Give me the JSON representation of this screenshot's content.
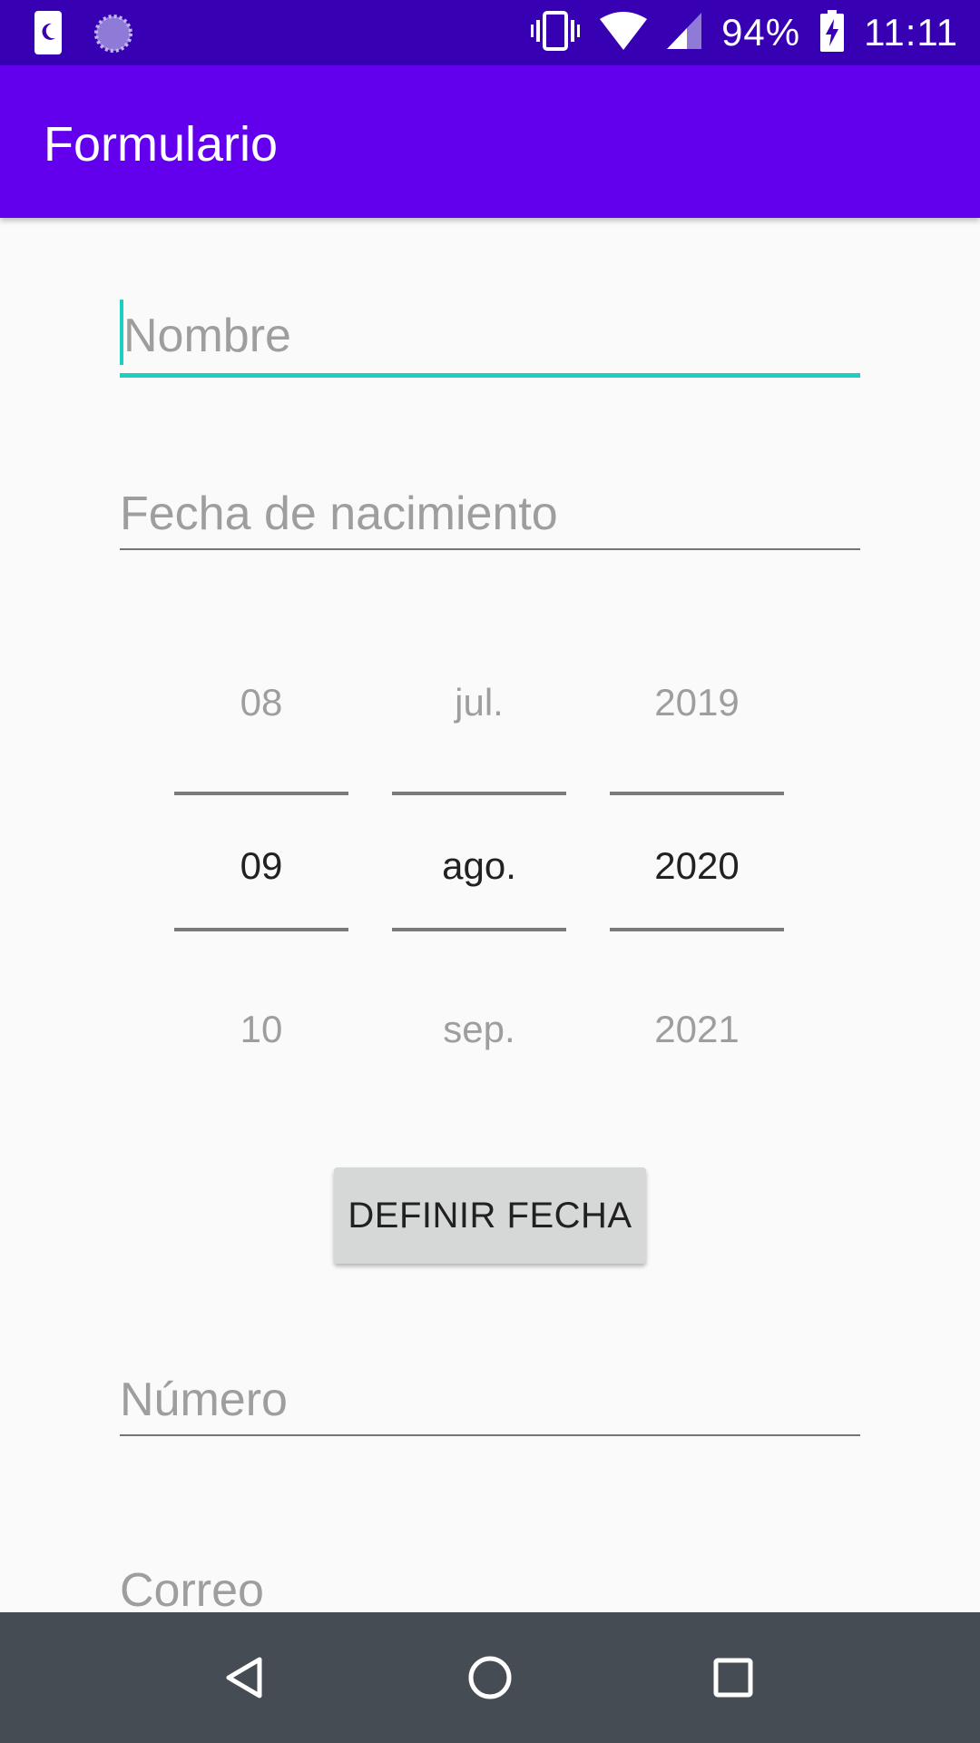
{
  "status_bar": {
    "battery": "94%",
    "time": "11:11",
    "icons": [
      "moon-app-icon",
      "loading-circle-icon",
      "vibrate-icon",
      "wifi-icon",
      "cell-signal-icon",
      "battery-charging-icon"
    ]
  },
  "app_bar": {
    "title": "Formulario"
  },
  "form": {
    "nombre": {
      "placeholder": "Nombre",
      "value": ""
    },
    "fecha": {
      "placeholder": "Fecha de nacimiento",
      "value": ""
    },
    "numero": {
      "placeholder": "Número",
      "value": ""
    },
    "correo": {
      "placeholder": "Correo",
      "value": ""
    }
  },
  "date_picker": {
    "day": {
      "prev": "08",
      "selected": "09",
      "next": "10"
    },
    "month": {
      "prev": "jul.",
      "selected": "ago.",
      "next": "sep."
    },
    "year": {
      "prev": "2019",
      "selected": "2020",
      "next": "2021"
    }
  },
  "button": {
    "label": "DEFINIR FECHA"
  },
  "nav_bar": {
    "icons": [
      "back-icon",
      "home-icon",
      "recents-icon"
    ]
  },
  "colors": {
    "status_bar": "#3700b3",
    "app_bar": "#6200ee",
    "accent": "#1dcfc0",
    "nav_bar": "#454c53"
  }
}
